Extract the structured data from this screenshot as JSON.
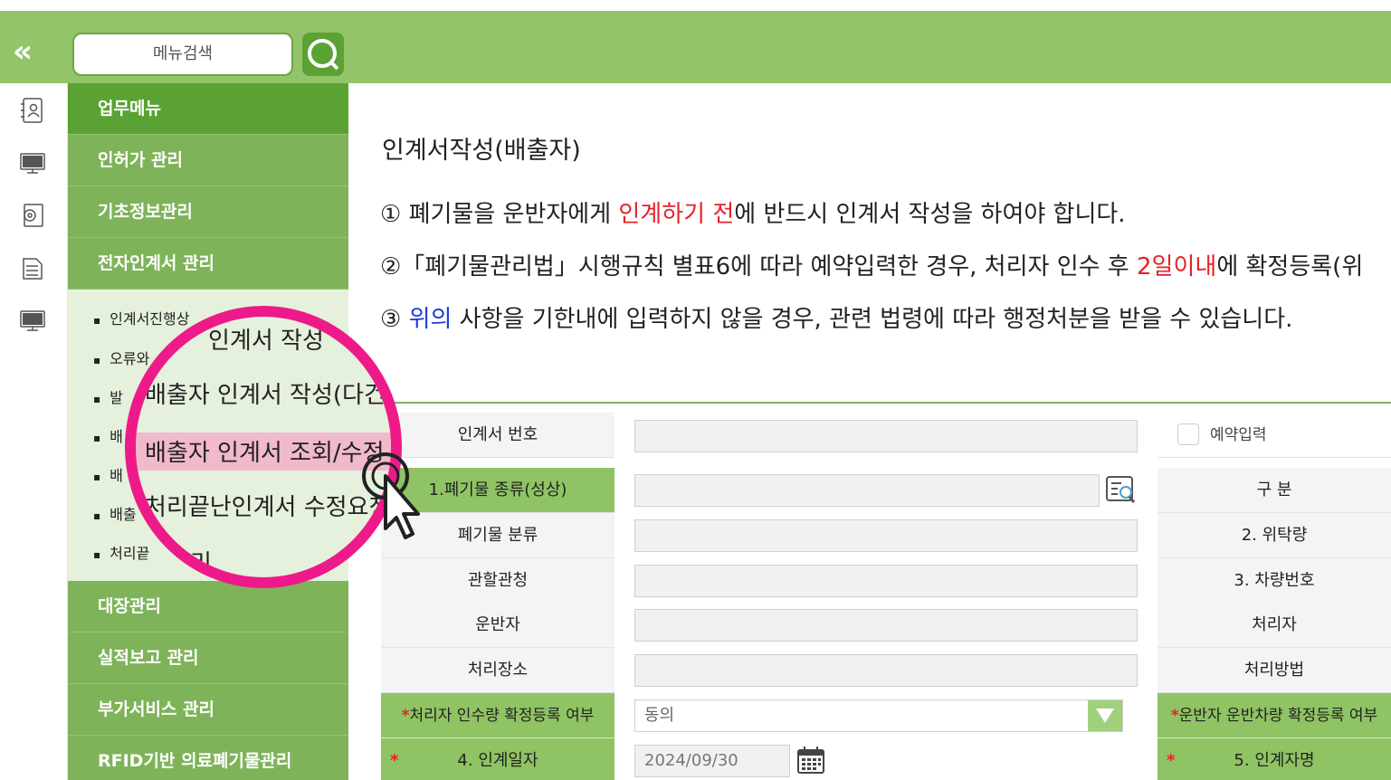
{
  "header": {
    "collapse_label": "«",
    "search_placeholder": "메뉴검색",
    "search_icon": "search-icon",
    "accent": "#93c46a"
  },
  "rail": {
    "icons": [
      "contacts-icon",
      "monitor-icon",
      "settings-doc-icon",
      "document-stack-icon",
      "monitor-icon"
    ]
  },
  "sidebar": {
    "items": [
      {
        "label": "업무메뉴"
      },
      {
        "label": "인허가 관리"
      },
      {
        "label": "기초정보관리"
      },
      {
        "label": "전자인계서 관리"
      },
      {
        "label": "대장관리"
      },
      {
        "label": "실적보고 관리"
      },
      {
        "label": "부가서비스 관리"
      },
      {
        "label": "RFID기반 의료폐기물관리"
      }
    ],
    "subitems": [
      {
        "label": "인계서진행상"
      },
      {
        "label": "오류와"
      },
      {
        "label": "발"
      },
      {
        "label": "배"
      },
      {
        "label": "배"
      },
      {
        "label": "배출"
      },
      {
        "label": "처리끝"
      }
    ]
  },
  "magnifier": {
    "lines": [
      "인계서 작성",
      "배출자 인계서 작성(다건",
      "배출자 인계서 조회/수정",
      "처리끝난인계서 수정요청",
      "리"
    ],
    "ring_color": "#ee1a8a"
  },
  "main": {
    "title": "인계서작성(배출자)",
    "notices": [
      {
        "parts": [
          "① 폐기물을 운반자에게 ",
          "인계하기 전",
          "에 반드시 인계서 작성을 하여야 합니다."
        ]
      },
      {
        "parts": [
          "②「폐기물관리법」시행규칙 별표6에 따라 예약입력한 경우, 처리자 인수 후 ",
          "2일이내",
          "에 확정등록(위"
        ]
      },
      {
        "parts": [
          "③ ",
          "위의",
          " 사항을 기한내에 입력하지 않을 경우, 관련 법령에 따라 행정처분을 받을 수 있습니다."
        ]
      }
    ]
  },
  "form": {
    "labels": [
      "인계서 번호",
      "1.폐기물 종류(성상)",
      "폐기물 분류",
      "관할관청",
      "운반자",
      "처리장소",
      "처리자 인수량 확정등록 여부",
      "4. 인계일자"
    ],
    "right_labels": [
      "예약입력",
      "구 분",
      "2. 위탁량",
      "3. 차량번호",
      "처리자",
      "처리방법",
      "운반자 운반차량 확정등록 여부",
      "5. 인계자명"
    ],
    "required_mark": "*",
    "consent_value": "동의",
    "date_value": "2024/09/30"
  }
}
